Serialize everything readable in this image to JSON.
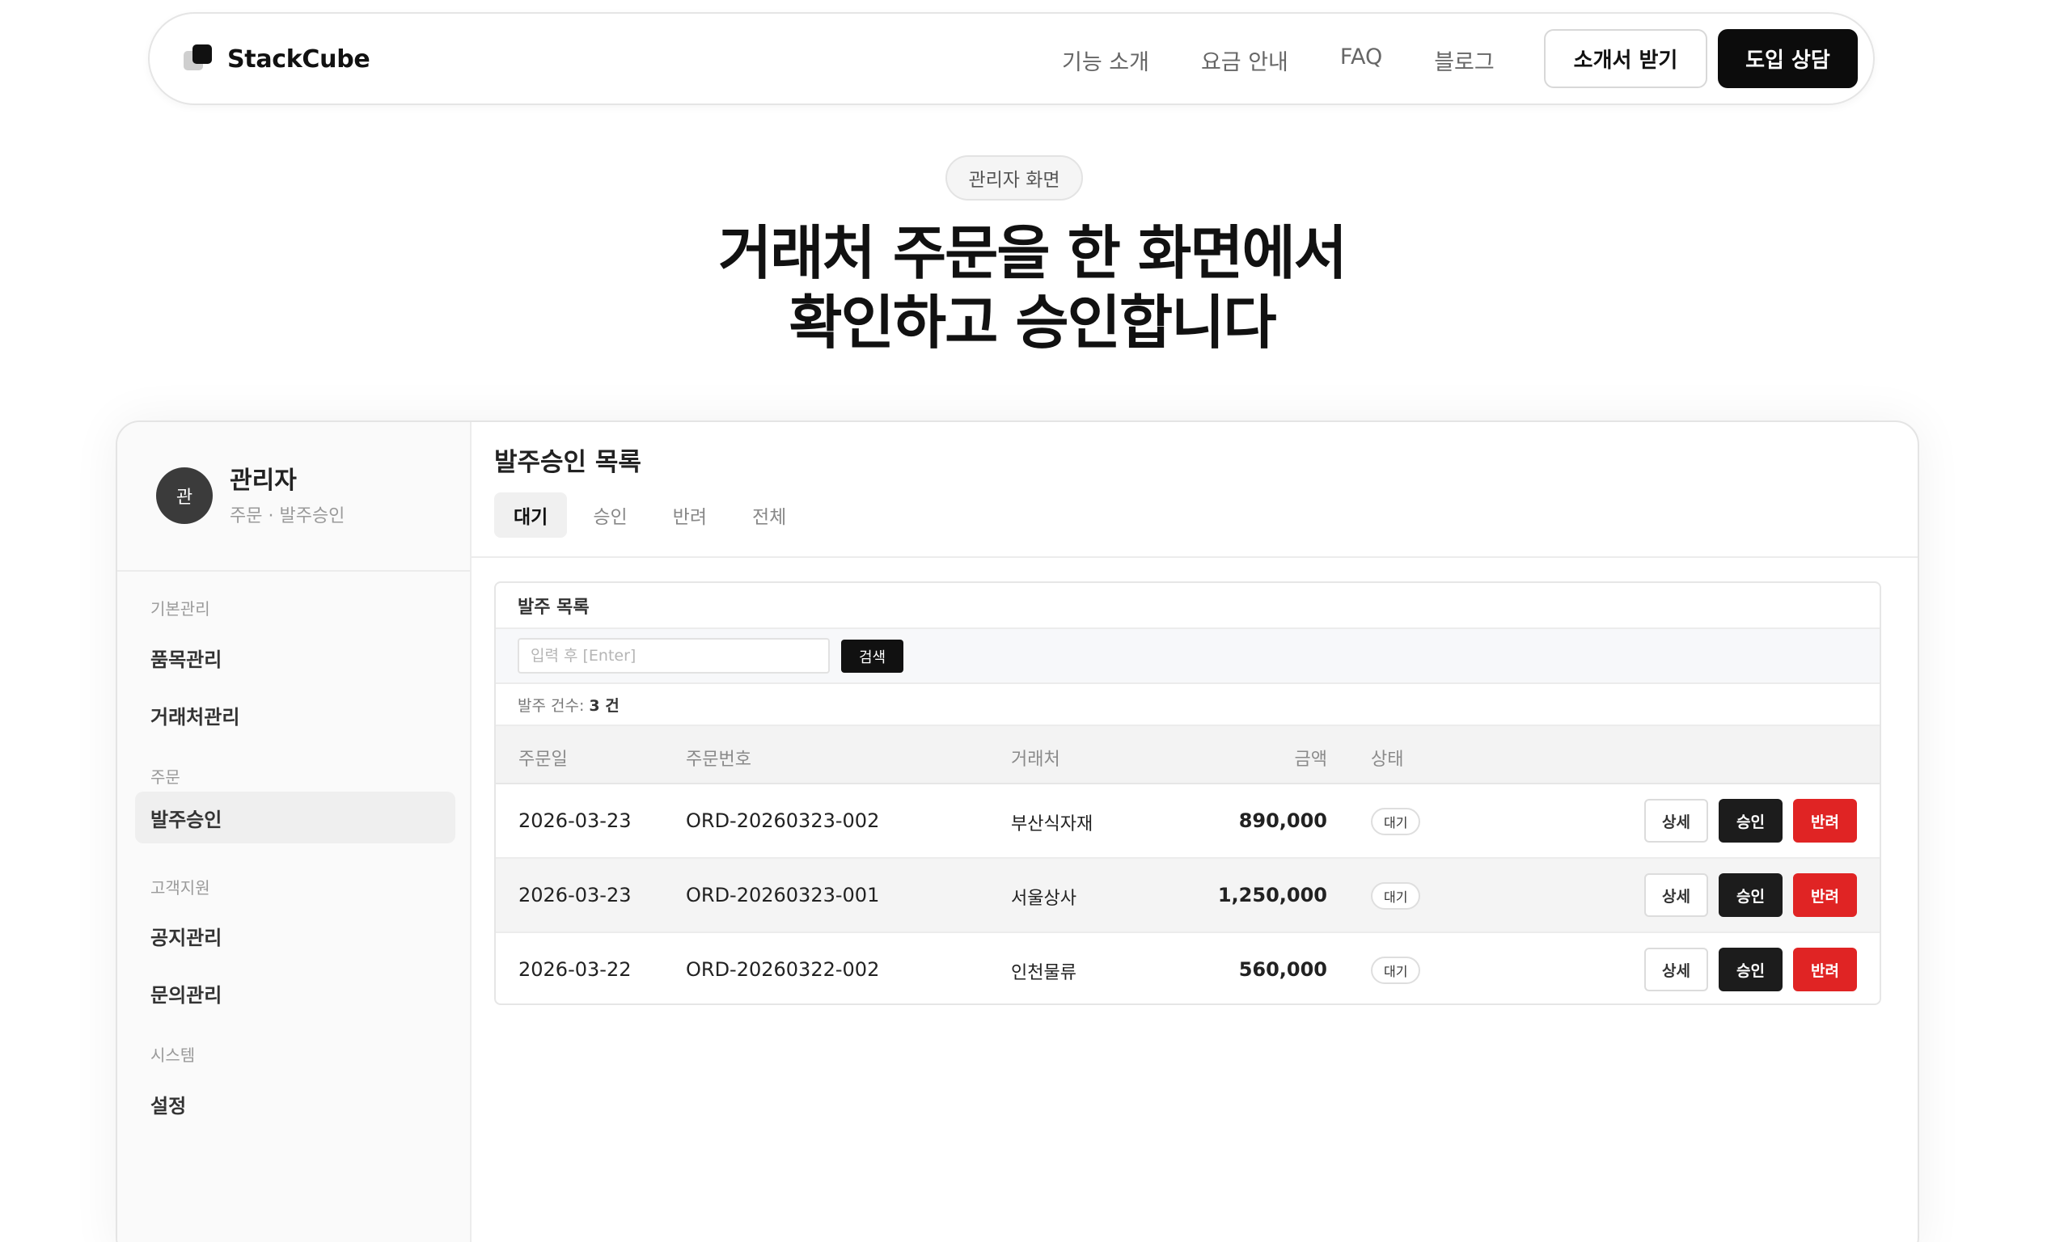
{
  "nav": {
    "brand": "StackCube",
    "menu": [
      "기능 소개",
      "요금 안내",
      "FAQ",
      "블로그"
    ],
    "brochure_button": "소개서 받기",
    "consult_button": "도입 상담"
  },
  "hero": {
    "badge": "관리자 화면",
    "title_line1": "거래처 주문을 한 화면에서",
    "title_line2": "확인하고 승인합니다"
  },
  "admin": {
    "profile": {
      "avatar": "관",
      "name": "관리자",
      "role": "주문 · 발주승인"
    },
    "sidebar": {
      "groups": [
        {
          "label": "기본관리",
          "items": [
            "품목관리",
            "거래처관리"
          ]
        },
        {
          "label": "주문",
          "items": [
            "발주승인"
          ]
        },
        {
          "label": "고객지원",
          "items": [
            "공지관리",
            "문의관리"
          ]
        },
        {
          "label": "시스템",
          "items": [
            "설정"
          ]
        }
      ],
      "active_item": "발주승인"
    },
    "page_title": "발주승인 목록",
    "tabs": [
      "대기",
      "승인",
      "반려",
      "전체"
    ],
    "active_tab": "대기",
    "panel": {
      "title": "발주 목록",
      "search_placeholder": "입력 후 [Enter]",
      "search_button": "검색",
      "count_label": "발주 건수:",
      "count_value": "3 건",
      "columns": {
        "date": "주문일",
        "order_no": "주문번호",
        "vendor": "거래처",
        "amount": "금액",
        "status": "상태"
      },
      "rows": [
        {
          "date": "2026-03-23",
          "order_no": "ORD-20260323-002",
          "vendor": "부산식자재",
          "amount": "890,000",
          "status": "대기"
        },
        {
          "date": "2026-03-23",
          "order_no": "ORD-20260323-001",
          "vendor": "서울상사",
          "amount": "1,250,000",
          "status": "대기"
        },
        {
          "date": "2026-03-22",
          "order_no": "ORD-20260322-002",
          "vendor": "인천물류",
          "amount": "560,000",
          "status": "대기"
        }
      ],
      "actions": {
        "detail": "상세",
        "approve": "승인",
        "reject": "반려"
      }
    }
  },
  "colors": {
    "primary": "#0c0c0c",
    "reject": "#e02424",
    "muted": "#9a9a9a",
    "border": "#e6e6e6"
  }
}
